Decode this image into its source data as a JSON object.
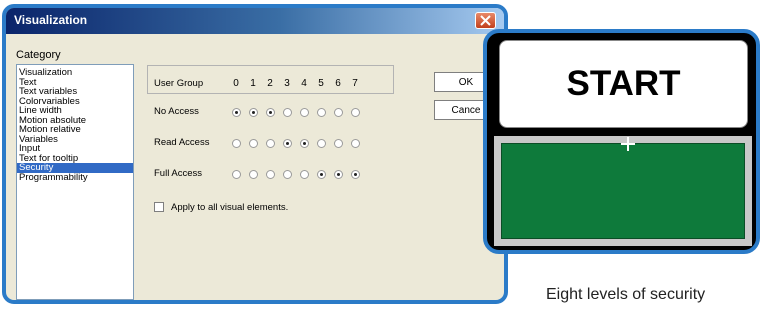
{
  "dialog": {
    "title": "Visualization",
    "category_label": "Category",
    "categories": [
      {
        "label": "Visualization",
        "selected": false
      },
      {
        "label": "Text",
        "selected": false
      },
      {
        "label": "Text variables",
        "selected": false
      },
      {
        "label": "Colorvariables",
        "selected": false
      },
      {
        "label": "Line width",
        "selected": false
      },
      {
        "label": "Motion absolute",
        "selected": false
      },
      {
        "label": "Motion relative",
        "selected": false
      },
      {
        "label": "Variables",
        "selected": false
      },
      {
        "label": "Input",
        "selected": false
      },
      {
        "label": "Text for tooltip",
        "selected": false
      },
      {
        "label": "Security",
        "selected": true
      },
      {
        "label": "Programmability",
        "selected": false
      }
    ],
    "user_group_label": "User Group",
    "group_numbers": [
      "0",
      "1",
      "2",
      "3",
      "4",
      "5",
      "6",
      "7"
    ],
    "rows": [
      {
        "label": "No Access",
        "checked": [
          true,
          true,
          true,
          false,
          false,
          false,
          false,
          false
        ]
      },
      {
        "label": "Read Access",
        "checked": [
          false,
          false,
          false,
          true,
          true,
          false,
          false,
          false
        ]
      },
      {
        "label": "Full Access",
        "checked": [
          false,
          false,
          false,
          false,
          false,
          true,
          true,
          true
        ]
      }
    ],
    "apply_all_label": "Apply to all visual elements.",
    "apply_all_checked": false,
    "ok_label": "OK",
    "cancel_label": "Cance"
  },
  "panel": {
    "start_label": "START",
    "area_color": "#0e7a3b"
  },
  "caption": "Eight levels of security",
  "colors": {
    "frame": "#2b7bc8",
    "selection": "#316ac5",
    "titlebar": "#0a246a"
  },
  "icons": {
    "close": "close-icon",
    "cursor": "crosshair-cursor-icon"
  }
}
